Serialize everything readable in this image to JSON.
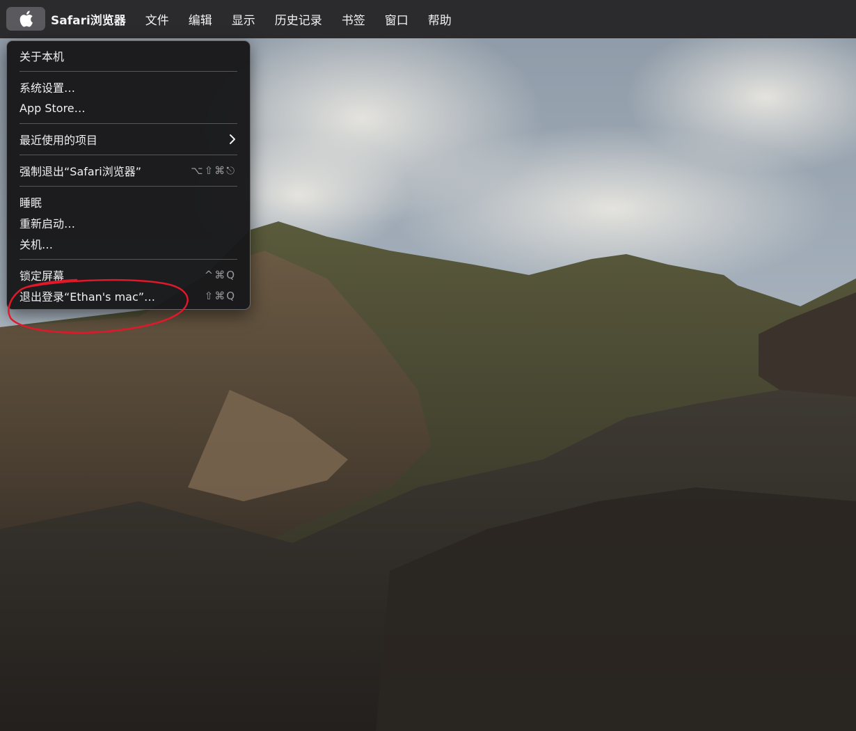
{
  "menubar": {
    "apple_icon": "apple-logo-icon",
    "items": [
      "Safari浏览器",
      "文件",
      "编辑",
      "显示",
      "历史记录",
      "书签",
      "窗口",
      "帮助"
    ]
  },
  "apple_menu": {
    "about": "关于本机",
    "system_settings": "系统设置…",
    "app_store": "App Store…",
    "recent_items": "最近使用的项目",
    "force_quit": "强制退出“Safari浏览器”",
    "force_quit_shortcut": "⌥⇧⌘⎋",
    "sleep": "睡眠",
    "restart": "重新启动…",
    "shutdown": "关机…",
    "lock_screen": "锁定屏幕",
    "lock_screen_shortcut": "^⌘Q",
    "logout": "退出登录“Ethan's mac”…",
    "logout_shortcut": "⇧⌘Q"
  },
  "colors": {
    "menubar_bg": "#2b2b2d",
    "menu_bg": "#18181a",
    "annotation": "#e0182a"
  }
}
